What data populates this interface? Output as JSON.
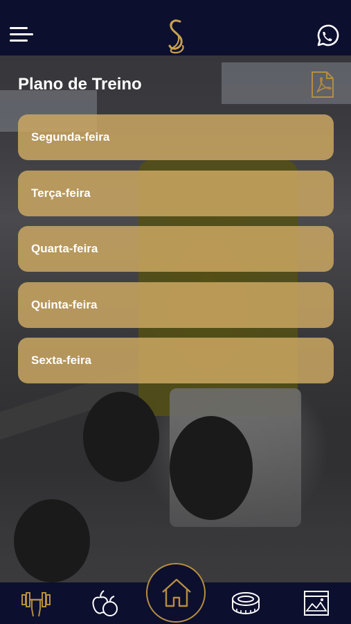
{
  "header": {
    "menu_icon": "hamburger-menu-icon",
    "logo": "brand-logo",
    "whatsapp_icon": "whatsapp-icon"
  },
  "main": {
    "title": "Plano de Treino",
    "pdf_icon": "pdf-file-icon",
    "days": [
      {
        "label": "Segunda-feira"
      },
      {
        "label": "Terça-feira"
      },
      {
        "label": "Quarta-feira"
      },
      {
        "label": "Quinta-feira"
      },
      {
        "label": "Sexta-feira"
      }
    ]
  },
  "bottom_nav": {
    "items": [
      {
        "icon": "dumbbell-icon"
      },
      {
        "icon": "nutrition-icon"
      },
      {
        "icon": "home-icon"
      },
      {
        "icon": "measuring-tape-icon"
      },
      {
        "icon": "gallery-icon"
      }
    ]
  },
  "colors": {
    "navy": "#0c0f2e",
    "gold": "#cda862",
    "gold_accent": "#b68e3e",
    "text": "#ffffff"
  }
}
